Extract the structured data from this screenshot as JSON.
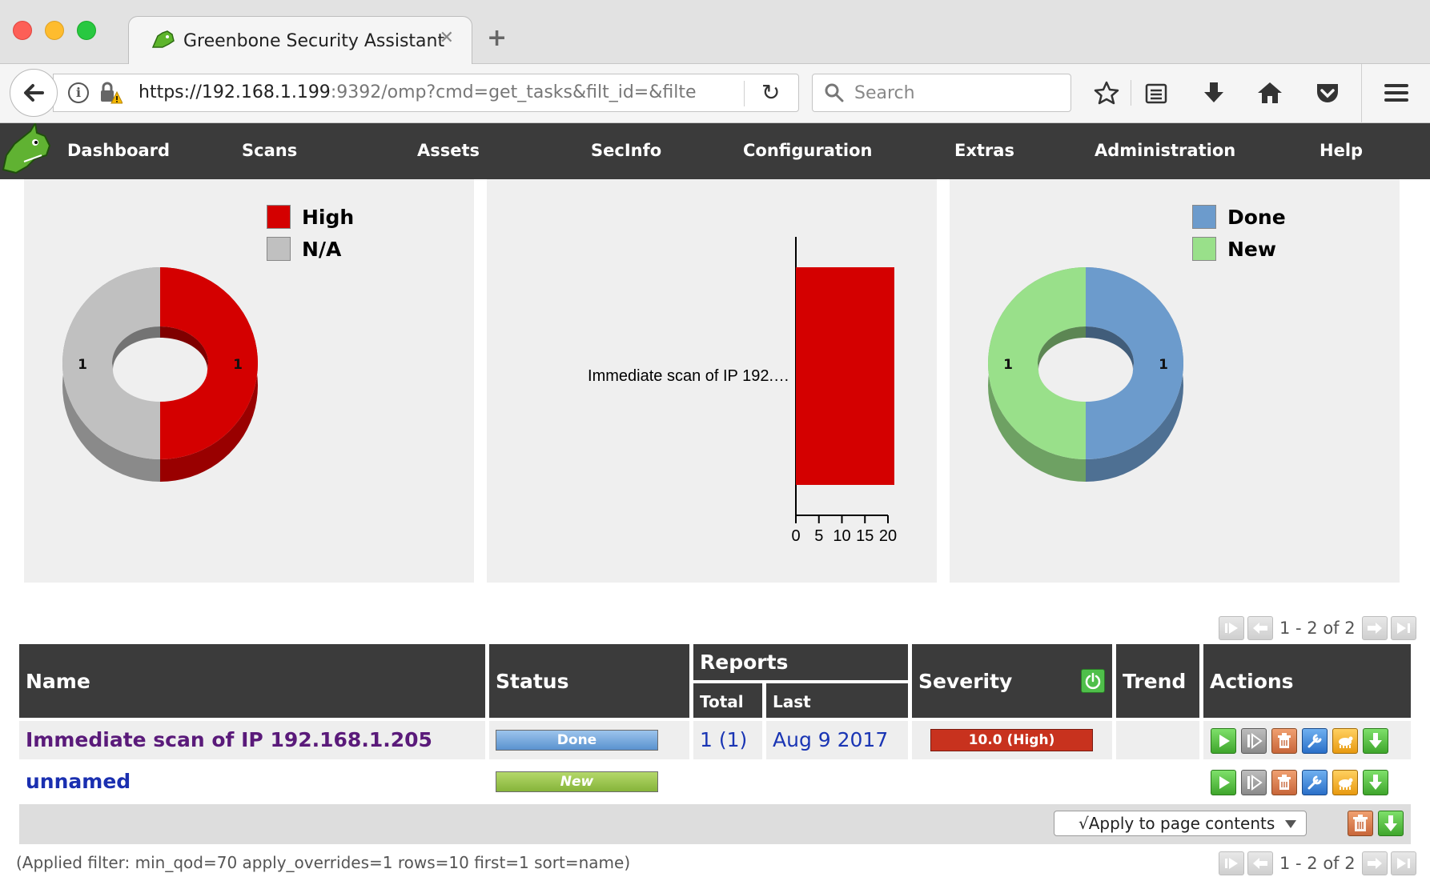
{
  "browser": {
    "tab_title": "Greenbone Security Assistant",
    "url_host": "https://192.168.1.199",
    "url_rest": ":9392/omp?cmd=get_tasks&filt_id=&filte",
    "search_placeholder": "Search"
  },
  "nav": {
    "items": [
      "Dashboard",
      "Scans",
      "Assets",
      "SecInfo",
      "Configuration",
      "Extras",
      "Administration",
      "Help"
    ]
  },
  "charts": {
    "severity_legend": [
      "High",
      "N/A"
    ],
    "status_legend": [
      "Done",
      "New"
    ],
    "bar_category": "Immediate scan of IP 192.…",
    "bar_ticks": [
      "0",
      "5",
      "10",
      "15",
      "20"
    ]
  },
  "chart_data": [
    {
      "type": "pie",
      "title": "",
      "labels": [
        "High",
        "N/A"
      ],
      "values": [
        1,
        1
      ],
      "colors": [
        "#d40000",
        "#c0c0c0"
      ],
      "legend": "top-right"
    },
    {
      "type": "bar",
      "title": "",
      "orientation": "horizontal",
      "categories": [
        "Immediate scan of IP 192.…"
      ],
      "values": [
        20
      ],
      "xlim": [
        0,
        20
      ],
      "xticks": [
        0,
        5,
        10,
        15,
        20
      ],
      "colors": [
        "#d40000"
      ]
    },
    {
      "type": "pie",
      "title": "",
      "labels": [
        "Done",
        "New"
      ],
      "values": [
        1,
        1
      ],
      "colors": [
        "#6c9bcc",
        "#99e08a"
      ],
      "legend": "top-right"
    }
  ],
  "pager": {
    "text": "1 - 2 of 2"
  },
  "table": {
    "headers": {
      "name": "Name",
      "status": "Status",
      "reports": "Reports",
      "total": "Total",
      "last": "Last",
      "severity": "Severity",
      "trend": "Trend",
      "actions": "Actions"
    },
    "rows": [
      {
        "name": "Immediate scan of IP 192.168.1.205",
        "status": "Done",
        "total": "1 (1)",
        "last": "Aug 9 2017",
        "severity": "10.0 (High)"
      },
      {
        "name": "unnamed",
        "status": "New",
        "total": "",
        "last": "",
        "severity": ""
      }
    ]
  },
  "bulk": {
    "apply_label": "√Apply to page contents"
  },
  "footer": {
    "filter": "(Applied filter: min_qod=70 apply_overrides=1 rows=10 first=1 sort=name)"
  },
  "colors": {
    "high": "#d40000",
    "na": "#c0c0c0",
    "done": "#6c9bcc",
    "new": "#99e08a",
    "nav_bg": "#3b3b3b"
  }
}
